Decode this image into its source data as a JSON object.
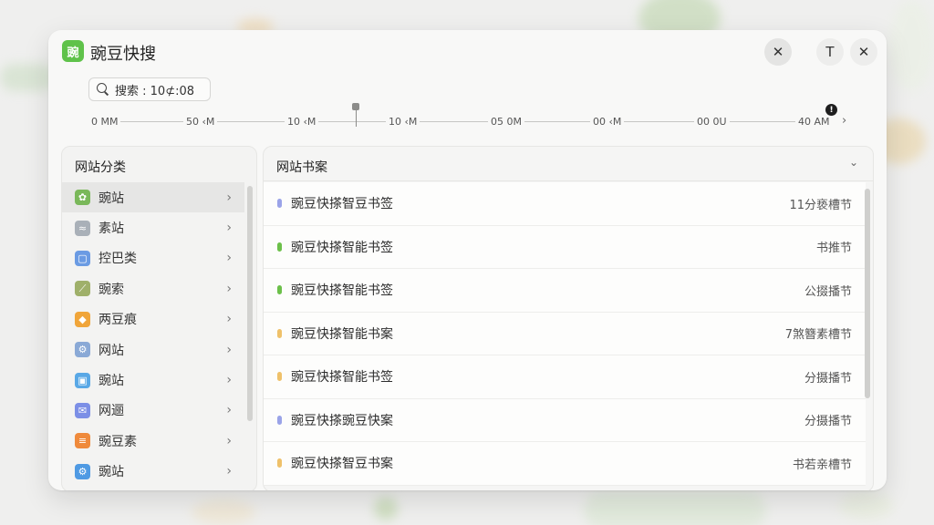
{
  "app": {
    "logo_text": "豌",
    "title": "豌豆快搜"
  },
  "window_controls": {
    "close_circle": "✕",
    "t_button": "T",
    "close": "✕"
  },
  "search": {
    "label": "搜索 : 10⊄:08"
  },
  "timeline": {
    "ticks": [
      {
        "label": "0 MM"
      },
      {
        "label": "50 ‹M"
      },
      {
        "label": "10 ‹M"
      },
      {
        "label": "10 ‹M"
      },
      {
        "label": "05 0M"
      },
      {
        "label": "00 ‹M"
      },
      {
        "label": "00 0U"
      },
      {
        "label": "40 AM"
      }
    ],
    "info_icon": "!",
    "next_chevron": "›"
  },
  "sidebar": {
    "title": "网站分类",
    "items": [
      {
        "label": "豌站",
        "icon": "pea-icon",
        "icon_glyph": "✿",
        "icon_color": "#7ab85a",
        "active": true
      },
      {
        "label": "素站",
        "icon": "chart-icon",
        "icon_glyph": "≈",
        "icon_color": "#a9b0b8"
      },
      {
        "label": "控巴类",
        "icon": "window-icon",
        "icon_glyph": "▢",
        "icon_color": "#6b9be3"
      },
      {
        "label": "豌索",
        "icon": "pea-pod-icon",
        "icon_glyph": "⟋",
        "icon_color": "#9fb06a"
      },
      {
        "label": "两豆痕",
        "icon": "coin-icon",
        "icon_glyph": "◆",
        "icon_color": "#f0a53a"
      },
      {
        "label": "网站",
        "icon": "gear-outline-icon",
        "icon_glyph": "⚙",
        "icon_color": "#8aa9d6"
      },
      {
        "label": "豌站",
        "icon": "image-icon",
        "icon_glyph": "▣",
        "icon_color": "#59a8e6"
      },
      {
        "label": "网逦",
        "icon": "mail-icon",
        "icon_glyph": "✉",
        "icon_color": "#7c8fe6"
      },
      {
        "label": "豌豆素",
        "icon": "list-icon",
        "icon_glyph": "≡",
        "icon_color": "#ef8a3c"
      },
      {
        "label": "豌站",
        "icon": "settings-icon",
        "icon_glyph": "⚙",
        "icon_color": "#4f9ae3"
      }
    ],
    "chevron": "›"
  },
  "main": {
    "title": "网站书案",
    "header_chevron": "⌄",
    "rows": [
      {
        "title": "豌豆快搽智豆书签",
        "right": "11分亵槽节",
        "dot_color": "#9aa3e8"
      },
      {
        "title": "豌豆快搽智能书签",
        "right": "书推节",
        "dot_color": "#6cc04a"
      },
      {
        "title": "豌豆快搽智能书签",
        "right": "公掇播节",
        "dot_color": "#6cc04a"
      },
      {
        "title": "豌豆快搽智能书案",
        "right": "7煞簪素槽节",
        "dot_color": "#efc16a"
      },
      {
        "title": "豌豆快搽智能书签",
        "right": "分摄播节",
        "dot_color": "#efc16a"
      },
      {
        "title": "豌豆快搽豌豆快案",
        "right": "分摄播节",
        "dot_color": "#9aa3e8"
      },
      {
        "title": "豌豆快搽智豆书案",
        "right": "书若亲槽节",
        "dot_color": "#efc16a"
      }
    ]
  }
}
